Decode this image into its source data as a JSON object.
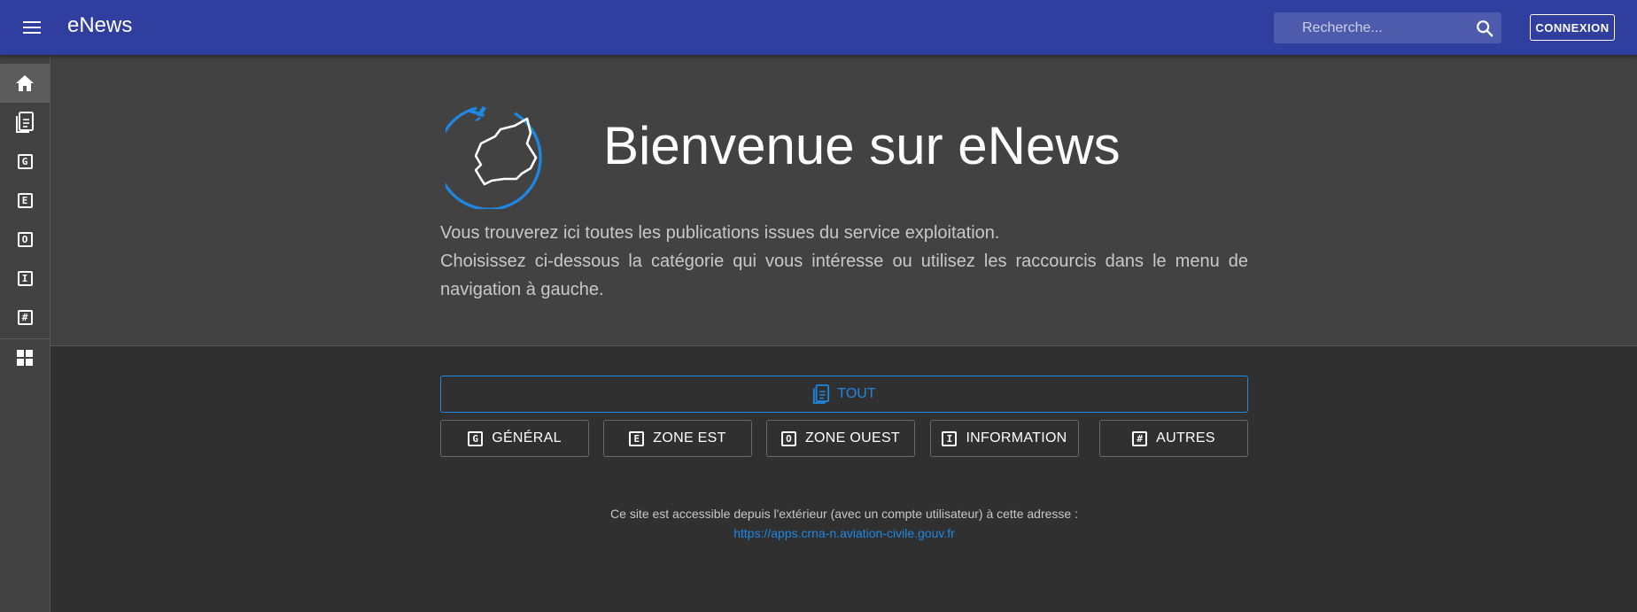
{
  "header": {
    "title": "eNews",
    "search_placeholder": "Recherche...",
    "login_label": "CONNEXION"
  },
  "sidebar": {
    "items": [
      {
        "icon": "home-icon",
        "active": true
      },
      {
        "icon": "documents-icon"
      },
      {
        "icon": "letter-g-icon",
        "letter": "G"
      },
      {
        "icon": "letter-e-icon",
        "letter": "E"
      },
      {
        "icon": "letter-o-icon",
        "letter": "O"
      },
      {
        "icon": "letter-i-icon",
        "letter": "I"
      },
      {
        "icon": "hash-icon",
        "letter": "#"
      },
      {
        "icon": "dashboard-icon"
      }
    ]
  },
  "hero": {
    "title": "Bienvenue sur eNews",
    "line1": "Vous trouverez ici toutes les publications issues du service exploitation.",
    "line2": "Choisissez ci-dessous la catégorie qui vous intéresse ou utilisez les raccourcis dans le menu de navigation à gauche."
  },
  "categories": {
    "all_label": "TOUT",
    "items": [
      {
        "label": "GÉNÉRAL",
        "letter": "G"
      },
      {
        "label": "ZONE EST",
        "letter": "E"
      },
      {
        "label": "ZONE OUEST",
        "letter": "O"
      },
      {
        "label": "INFORMATION",
        "letter": "I"
      },
      {
        "label": "AUTRES",
        "letter": "#"
      }
    ]
  },
  "footer": {
    "text": "Ce site est accessible depuis l'extérieur (avec un compte utilisateur) à cette adresse :",
    "link": "https://apps.crna-n.aviation-civile.gouv.fr"
  },
  "colors": {
    "topbar": "#303f9f",
    "accent": "#1e88e5",
    "sidebar": "#424242",
    "hero": "#424242",
    "background": "#303030"
  }
}
